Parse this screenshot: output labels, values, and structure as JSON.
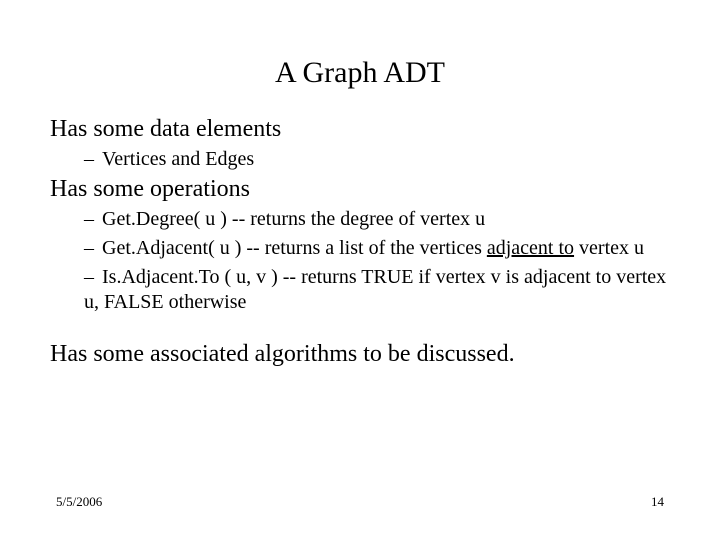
{
  "title": "A Graph ADT",
  "section1": {
    "heading": "Has some data elements",
    "items": [
      "Vertices and Edges"
    ]
  },
  "section2": {
    "heading": "Has some operations",
    "items": [
      {
        "text": "Get.Degree( u ) -- returns the degree of vertex u"
      },
      {
        "pre": "Get.Adjacent( u ) -- returns a list of the vertices ",
        "underlined": "adjacent to",
        "post": "  vertex u"
      },
      {
        "text": "Is.Adjacent.To ( u, v )  -- returns TRUE if vertex v is adjacent to vertex u, FALSE otherwise"
      }
    ]
  },
  "section3": {
    "heading": "Has some associated algorithms to be discussed."
  },
  "footer": {
    "date": "5/5/2006",
    "page": "14"
  },
  "dash": "–"
}
